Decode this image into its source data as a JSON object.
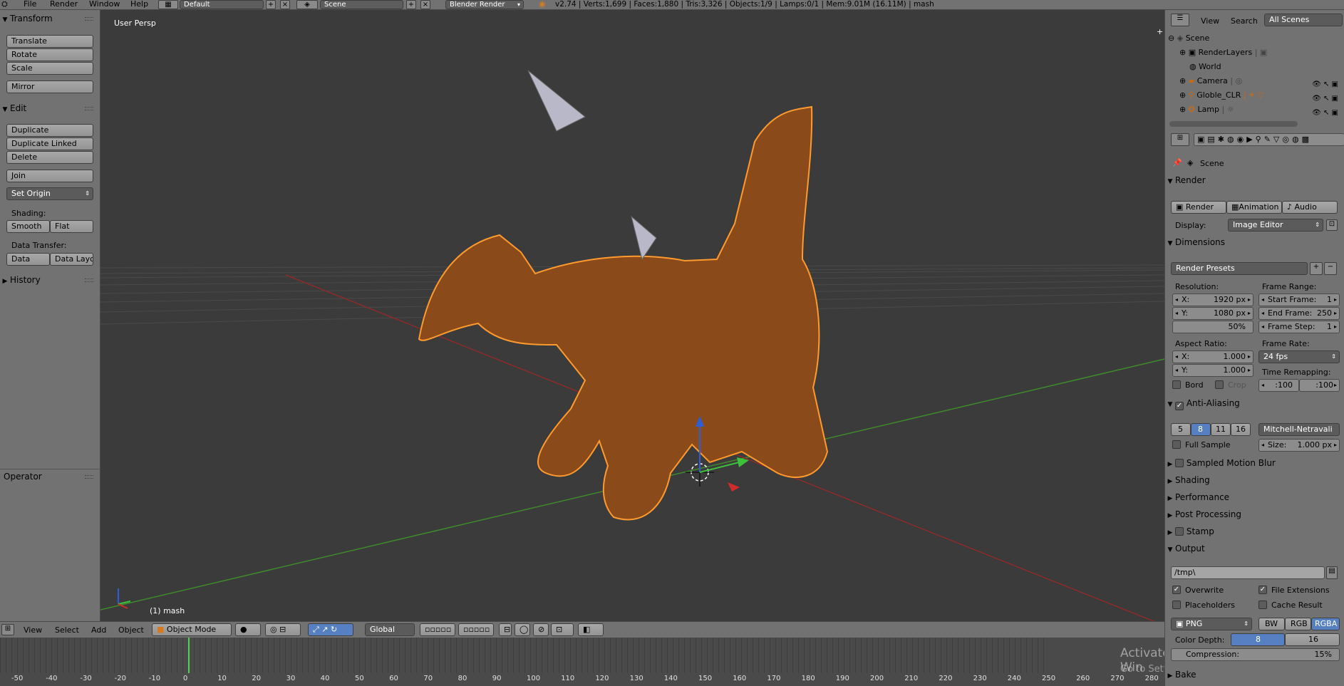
{
  "topbar": {
    "menus": [
      "File",
      "Render",
      "Window",
      "Help"
    ],
    "layout": "Default",
    "scene": "Scene",
    "engine": "Blender Render",
    "stats": "v2.74 | Verts:1,699 | Faces:1,880 | Tris:3,326 | Objects:1/9 | Lamps:0/1 | Mem:9.01M (16.11M) | mash"
  },
  "toolshelf": {
    "transform_title": "Transform",
    "translate": "Translate",
    "rotate": "Rotate",
    "scale": "Scale",
    "mirror": "Mirror",
    "edit_title": "Edit",
    "duplicate": "Duplicate",
    "duplicate_linked": "Duplicate Linked",
    "delete": "Delete",
    "join": "Join",
    "set_origin": "Set Origin",
    "shading_label": "Shading:",
    "smooth": "Smooth",
    "flat": "Flat",
    "data_transfer_label": "Data Transfer:",
    "data": "Data",
    "data_layout": "Data Layo",
    "history_title": "History",
    "operator_title": "Operator"
  },
  "viewport": {
    "view_label": "User Persp",
    "object_label": "(1) mash"
  },
  "header": {
    "view": "View",
    "select": "Select",
    "add": "Add",
    "object": "Object",
    "mode": "Object Mode",
    "orientation": "Global"
  },
  "timeline": {
    "ticks": [
      "-50",
      "-40",
      "-30",
      "-20",
      "-10",
      "0",
      "10",
      "20",
      "30",
      "40",
      "50",
      "60",
      "70",
      "80",
      "90",
      "100",
      "110",
      "120",
      "130",
      "140",
      "150",
      "160",
      "170",
      "180",
      "190",
      "200",
      "210",
      "220",
      "230",
      "240",
      "250",
      "260",
      "270",
      "280"
    ],
    "watermark_line1": "Activate Win",
    "watermark_line2": "Go to Settings to activate Windows."
  },
  "outliner": {
    "view": "View",
    "search": "Search",
    "filter": "All Scenes",
    "items": [
      "Scene",
      "RenderLayers",
      "World",
      "Camera",
      "Globle_CLR",
      "Lamp"
    ]
  },
  "properties": {
    "context": "Scene",
    "render_title": "Render",
    "render_btn": "Render",
    "animation_btn": "Animation",
    "audio_btn": "Audio",
    "display_label": "Display:",
    "display_value": "Image Editor",
    "dimensions_title": "Dimensions",
    "render_presets": "Render Presets",
    "resolution_label": "Resolution:",
    "res_x_key": "X:",
    "res_x": "1920 px",
    "res_y_key": "Y:",
    "res_y": "1080 px",
    "res_pct": "50%",
    "frame_range_label": "Frame Range:",
    "start_frame_key": "Start Frame:",
    "start_frame": "1",
    "end_frame_key": "End Frame:",
    "end_frame": "250",
    "frame_step_key": "Frame Step:",
    "frame_step": "1",
    "aspect_label": "Aspect Ratio:",
    "aspect_x_key": "X:",
    "aspect_x": "1.000",
    "aspect_y_key": "Y:",
    "aspect_y": "1.000",
    "frame_rate_label": "Frame Rate:",
    "frame_rate": "24 fps",
    "time_remap_label": "Time Remapping:",
    "remap_old": ":100",
    "remap_new": ":100",
    "bord": "Bord",
    "crop": "Crop",
    "aa_title": "Anti-Aliasing",
    "aa_5": "5",
    "aa_8": "8",
    "aa_11": "11",
    "aa_16": "16",
    "aa_filter": "Mitchell-Netravali",
    "full_sample": "Full Sample",
    "size_key": "Size:",
    "size_val": "1.000 px",
    "motion_blur_title": "Sampled Motion Blur",
    "shading_title": "Shading",
    "performance_title": "Performance",
    "post_processing_title": "Post Processing",
    "stamp_title": "Stamp",
    "output_title": "Output",
    "output_path": "/tmp\\",
    "overwrite": "Overwrite",
    "file_extensions": "File Extensions",
    "placeholders": "Placeholders",
    "cache_result": "Cache Result",
    "format": "PNG",
    "bw": "BW",
    "rgb": "RGB",
    "rgba": "RGBA",
    "color_depth_label": "Color Depth:",
    "depth_8": "8",
    "depth_16": "16",
    "compression_key": "Compression:",
    "compression_val": "15%",
    "bake_title": "Bake"
  },
  "colors": {
    "ui_gray": "#727272",
    "viewport_bg": "#3b3b3b",
    "selected_blue": "#5680c2",
    "outline_orange": "#ff9a2e"
  }
}
